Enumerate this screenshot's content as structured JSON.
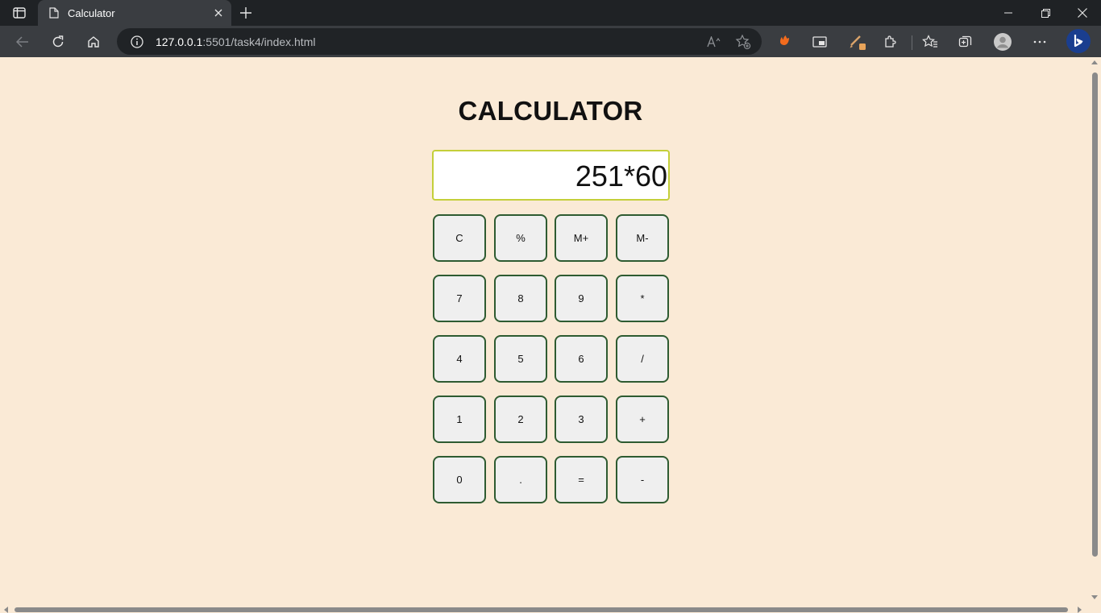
{
  "browser": {
    "tab_title": "Calculator",
    "url_host": "127.0.0.1",
    "url_rest": ":5501/task4/index.html"
  },
  "calculator": {
    "title": "CALCULATOR",
    "display": "251*60",
    "keys": [
      [
        "C",
        "%",
        "M+",
        "M-"
      ],
      [
        "7",
        "8",
        "9",
        "*"
      ],
      [
        "4",
        "5",
        "6",
        "/"
      ],
      [
        "1",
        "2",
        "3",
        "+"
      ],
      [
        "0",
        ".",
        "=",
        "-"
      ]
    ]
  },
  "colors": {
    "page_background": "#faead6",
    "display_border": "#c4cf3a",
    "key_border": "#2e5b31",
    "key_background": "#efefef"
  }
}
